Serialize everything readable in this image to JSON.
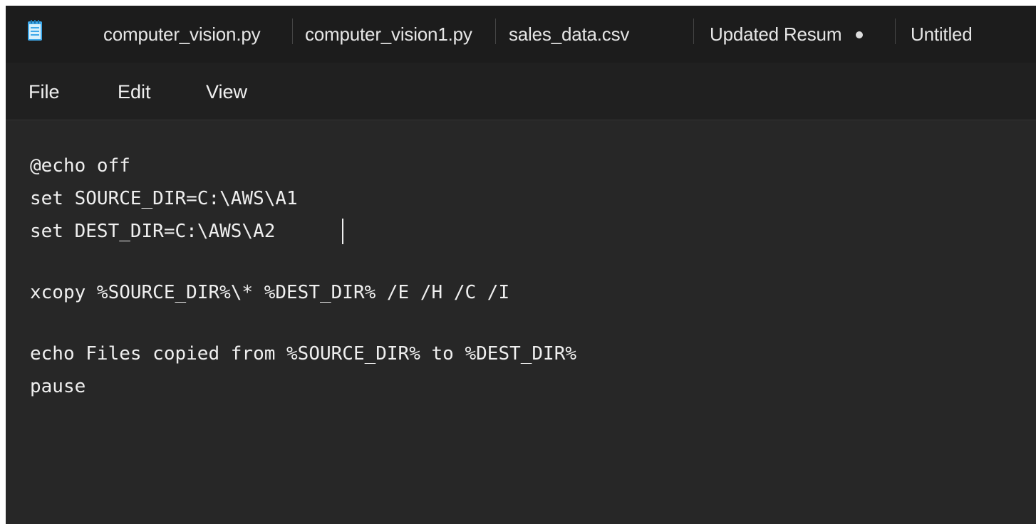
{
  "tabs": [
    {
      "label": "computer_vision.py"
    },
    {
      "label": "computer_vision1.py"
    },
    {
      "label": "sales_data.csv"
    },
    {
      "label": "Updated Resume"
    },
    {
      "label": "Untitled"
    }
  ],
  "icons": {
    "app": "notepad-icon",
    "unsaved": "unsaved-dot-icon"
  },
  "menu": {
    "file": "File",
    "edit": "Edit",
    "view": "View"
  },
  "editor": {
    "lines": [
      "@echo off",
      "set SOURCE_DIR=C:\\AWS\\A1",
      "set DEST_DIR=C:\\AWS\\A2",
      "",
      "xcopy %SOURCE_DIR%\\* %DEST_DIR% /E /H /C /I",
      "",
      "echo Files copied from %SOURCE_DIR% to %DEST_DIR%",
      "pause"
    ]
  },
  "colors": {
    "tabbar_bg": "#1c1c1c",
    "menubar_bg": "#202020",
    "editor_bg": "#272727",
    "text": "#efefef",
    "icon_accent": "#3fa8e8"
  }
}
